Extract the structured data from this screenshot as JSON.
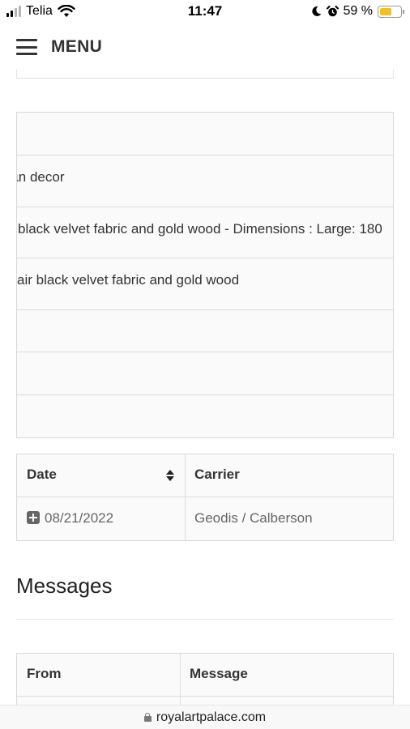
{
  "status_bar": {
    "carrier": "Telia",
    "time": "11:47",
    "battery_percent": "59 %",
    "battery_level": 0.59,
    "icons": [
      "signal-icon",
      "wifi-icon",
      "moon-icon",
      "alarm-icon",
      "battery-icon"
    ]
  },
  "header": {
    "menu_label": "MENU"
  },
  "products": {
    "rows": [
      {
        "text": ""
      },
      {
        "text": "ɩn decor"
      },
      {
        "text": "black velvet fabric and gold wood - Dimensions : Large: 180"
      },
      {
        "text": "air black velvet fabric and gold wood"
      },
      {
        "text": ""
      },
      {
        "text": ""
      },
      {
        "text": ""
      }
    ]
  },
  "tracking": {
    "headers": {
      "date": "Date",
      "carrier": "Carrier"
    },
    "rows": [
      {
        "date": "08/21/2022",
        "carrier": "Geodis / Calberson"
      }
    ]
  },
  "messages": {
    "heading": "Messages",
    "headers": {
      "from": "From",
      "message": "Message"
    }
  },
  "url_bar": {
    "domain": "royalartpalace.com"
  },
  "colors": {
    "battery_fill": "#f2c21a",
    "table_bg": "#fafafa",
    "border": "#d8d8d8",
    "muted_text": "#666666"
  }
}
